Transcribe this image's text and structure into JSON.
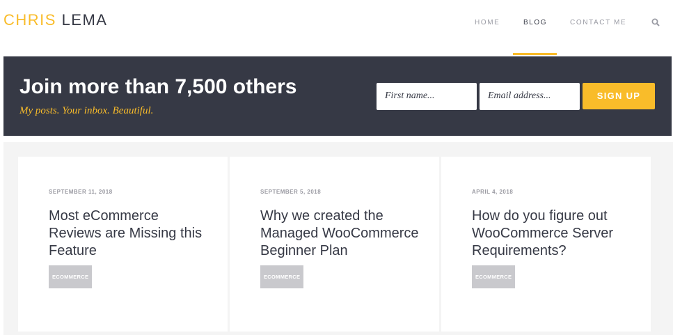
{
  "logo": {
    "first": "CHRIS",
    "last": " LEMA"
  },
  "nav": {
    "items": [
      {
        "label": "HOME"
      },
      {
        "label": "BLOG"
      },
      {
        "label": "CONTACT ME"
      }
    ],
    "active": "BLOG"
  },
  "banner": {
    "title": "Join more than 7,500 others",
    "subtitle": "My posts. Your inbox. Beautiful.",
    "first_name_placeholder": "First name...",
    "email_placeholder": "Email address...",
    "signup_label": "SIGN UP"
  },
  "posts": [
    {
      "date": "SEPTEMBER 11, 2018",
      "title": "Most eCommerce Reviews are Missing this Feature",
      "tag": "ECOMMERCE"
    },
    {
      "date": "SEPTEMBER 5, 2018",
      "title": "Why we created the Managed WooCommerce Beginner Plan",
      "tag": "ECOMMERCE"
    },
    {
      "date": "APRIL 4, 2018",
      "title": "How do you figure out WooCommerce Server Requirements?",
      "tag": "ECOMMERCE"
    }
  ]
}
